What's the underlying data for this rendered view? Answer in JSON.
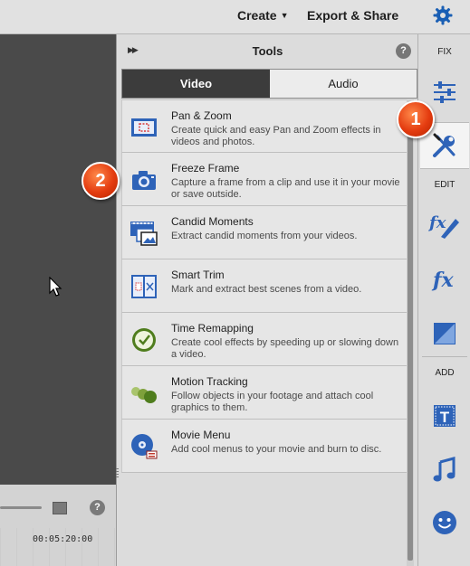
{
  "topbar": {
    "create": "Create",
    "export": "Export & Share"
  },
  "timeline": {
    "timecode": "00:05:20:00",
    "help": "?"
  },
  "panel": {
    "title": "Tools",
    "help": "?",
    "tabs": [
      {
        "label": "Video",
        "active": true
      },
      {
        "label": "Audio",
        "active": false
      }
    ],
    "tools": [
      {
        "name": "Pan & Zoom",
        "desc": "Create quick and easy Pan and Zoom effects in videos and photos.",
        "icon": "pan-zoom-icon"
      },
      {
        "name": "Freeze Frame",
        "desc": "Capture a frame from a clip and use it in your movie or save outside.",
        "icon": "camera-icon"
      },
      {
        "name": "Candid Moments",
        "desc": "Extract candid moments from your videos.",
        "icon": "film-frames-icon"
      },
      {
        "name": "Smart Trim",
        "desc": "Mark and extract best scenes from a video.",
        "icon": "smart-trim-icon"
      },
      {
        "name": "Time Remapping",
        "desc": "Create cool effects by speeding up or slowing down a video.",
        "icon": "clock-icon"
      },
      {
        "name": "Motion Tracking",
        "desc": "Follow objects in your footage and attach cool graphics to them.",
        "icon": "motion-tracking-icon"
      },
      {
        "name": "Movie Menu",
        "desc": "Add cool menus to your movie and burn to disc.",
        "icon": "disc-icon"
      }
    ]
  },
  "rightbar": {
    "fix": "FIX",
    "edit": "EDIT",
    "add": "ADD"
  },
  "callouts": {
    "one": "1",
    "two": "2"
  },
  "colors": {
    "accent": "#1a73c4",
    "callout": "#e43c10",
    "active_tab": "#3c3c3c"
  }
}
